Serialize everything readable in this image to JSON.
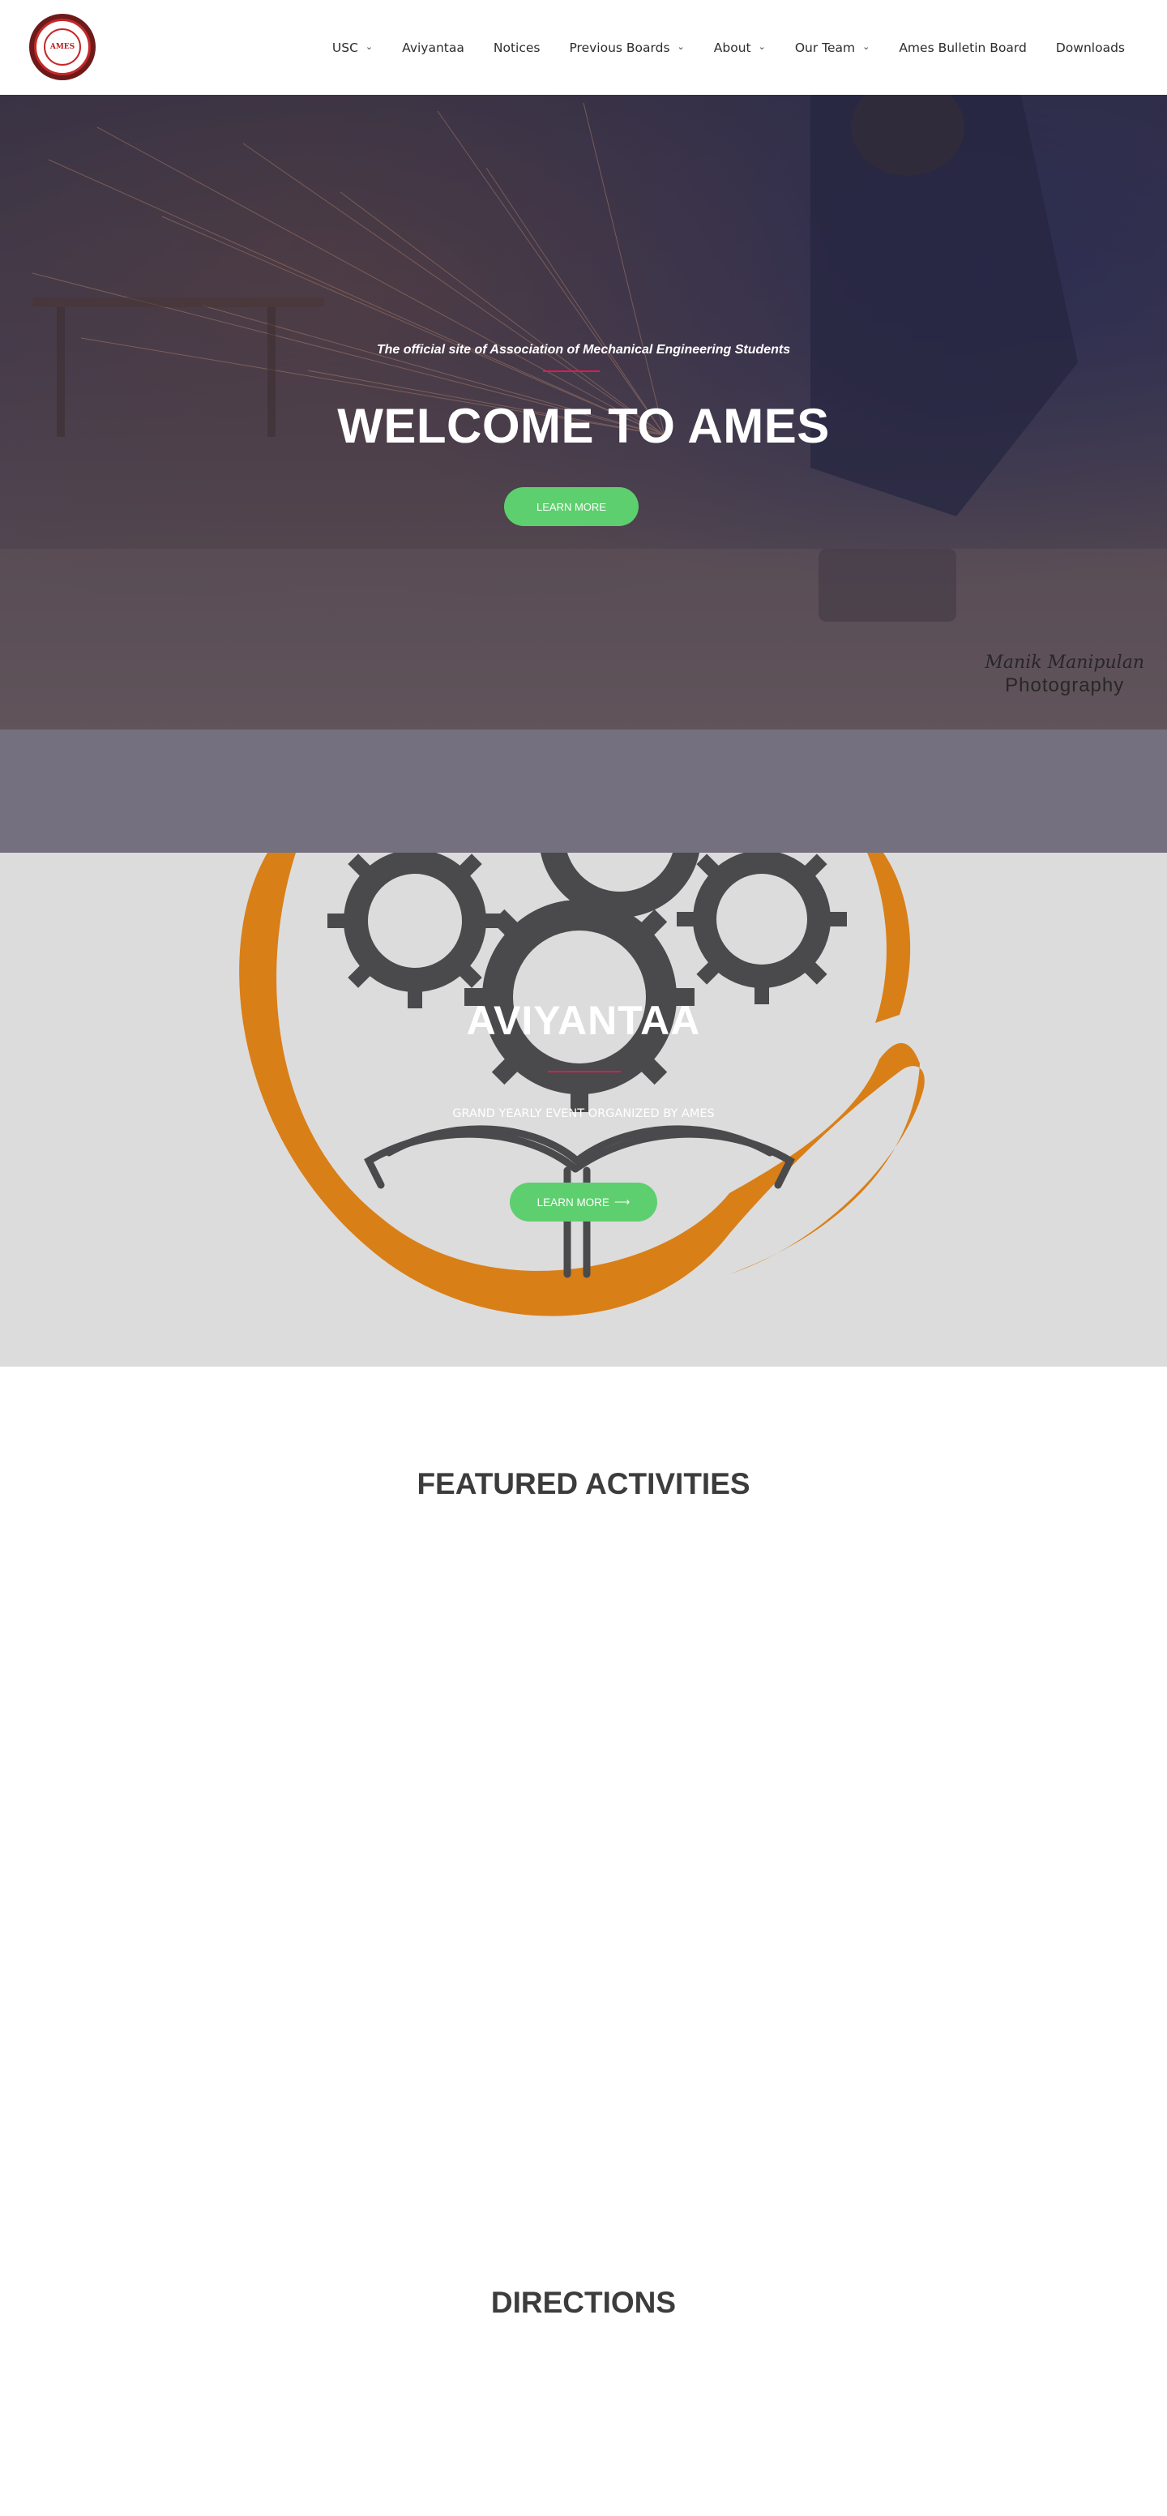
{
  "header": {
    "logo_alt": "AMES",
    "nav": [
      {
        "label": "USC",
        "has_dropdown": true
      },
      {
        "label": "Aviyantaa",
        "has_dropdown": false
      },
      {
        "label": "Notices",
        "has_dropdown": false
      },
      {
        "label": "Previous Boards",
        "has_dropdown": true
      },
      {
        "label": "About",
        "has_dropdown": true
      },
      {
        "label": "Our Team",
        "has_dropdown": true
      },
      {
        "label": "Ames Bulletin Board",
        "has_dropdown": false
      },
      {
        "label": "Downloads",
        "has_dropdown": false
      }
    ]
  },
  "hero": {
    "eyebrow": "The official site of Association of Mechanical Engineering Students",
    "title": "WELCOME TO AMES",
    "button_label": "LEARN MORE",
    "watermark_line1": "Manik Manipulan",
    "watermark_line2": "Photography"
  },
  "aviyantaa": {
    "title": "AVIYANTAA",
    "subtitle": "GRAND YEARLY EVENT ORGANIZED BY AMES",
    "button_label": "LEARN MORE",
    "button_arrow": "⟶"
  },
  "sections": {
    "featured_title": "FEATURED ACTIVITIES",
    "directions_title": "DIRECTIONS"
  },
  "colors": {
    "accent_green": "#5ecf6e",
    "accent_red": "#e6174f",
    "orange": "#d97f17",
    "gear_grey": "#4a4a4c"
  }
}
